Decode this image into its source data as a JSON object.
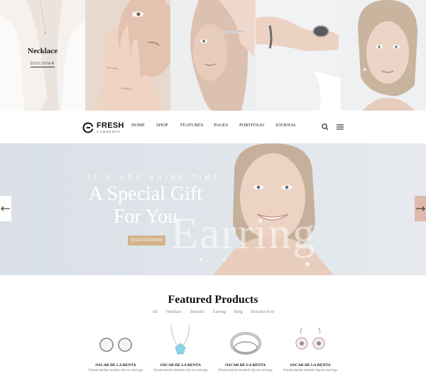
{
  "categories": {
    "featured_title": "Necklace",
    "featured_link": "DISCOVER"
  },
  "header": {
    "logo_name": "FRESH",
    "logo_sub": "COMMERCE",
    "nav": [
      "HOME",
      "SHOP",
      "FEATURES",
      "PAGES",
      "PORTFOLIO",
      "JOURNAL"
    ],
    "icons": [
      "search-icon",
      "menu-icon"
    ]
  },
  "hero": {
    "eyebrow": "IT`S YOU SHINE TIME",
    "title_line1": "A Special Gift",
    "title_line2": "For You",
    "watermark": "Earring",
    "button": "DISCOVER NOW",
    "prev_icon": "arrow-left-icon",
    "next_icon": "arrow-right-icon"
  },
  "featured": {
    "title": "Featured Products",
    "filters": [
      "All",
      "Necklace",
      "Bracelet",
      "Earring",
      "Ring",
      "Bracelet Foot"
    ],
    "products": [
      {
        "brand": "OSCAR DE LA RENTA",
        "desc": "Dreamcatcher beaded clip-on earrings"
      },
      {
        "brand": "OSCAR DE LA RENTA",
        "desc": "Dreamcatcher beaded clip-on earrings"
      },
      {
        "brand": "OSCAR DE LA RENTA",
        "desc": "Dreamcatcher beaded clip-on earrings"
      },
      {
        "brand": "OSCAR DE LA RENTA",
        "desc": "Dreamcatcher beaded clip-on earrings"
      }
    ]
  },
  "colors": {
    "accent": "#d4b38c",
    "next_arrow_bg": "#e0b9ab",
    "hero_bg": "#dfe5ea"
  }
}
